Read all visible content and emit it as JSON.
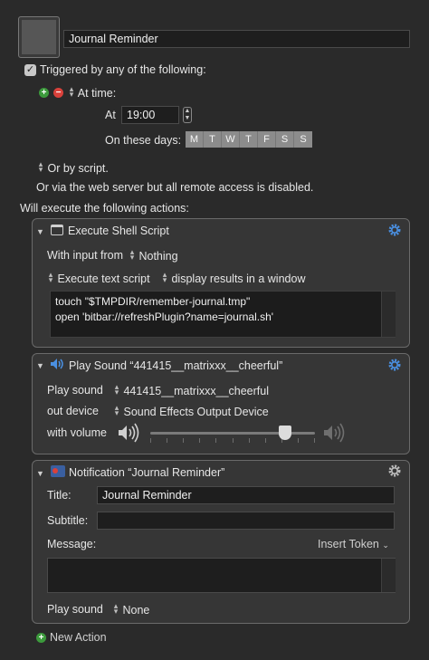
{
  "macro": {
    "name": "Journal Reminder"
  },
  "trigger": {
    "header": "Triggered by any of the following:",
    "at_time_label": "At time:",
    "at_label": "At",
    "time_value": "19:00",
    "days_label": "On these days:",
    "days": [
      "M",
      "T",
      "W",
      "T",
      "F",
      "S",
      "S"
    ],
    "by_script": "Or by script.",
    "web_server": "Or via the web server but all remote access is disabled."
  },
  "actions_header": "Will execute the following actions:",
  "shell_action": {
    "title": "Execute Shell Script",
    "input_label": "With input from",
    "input_value": "Nothing",
    "mode": "Execute text script",
    "output": "display results in a window",
    "script_lines": [
      "touch \"$TMPDIR/remember-journal.tmp\"",
      "open 'bitbar://refreshPlugin?name=journal.sh'"
    ]
  },
  "sound_action": {
    "title": "Play Sound “441415__matrixxx__cheerful”",
    "play_label": "Play sound",
    "play_value": "441415__matrixxx__cheerful",
    "device_label": "out device",
    "device_value": "Sound Effects Output Device",
    "volume_label": "with volume",
    "volume_fraction": 0.82
  },
  "notification_action": {
    "title": "Notification “Journal Reminder”",
    "title_label": "Title:",
    "title_value": "Journal Reminder",
    "subtitle_label": "Subtitle:",
    "subtitle_value": "",
    "message_label": "Message:",
    "insert_token": "Insert Token",
    "message_value": "",
    "sound_label": "Play sound",
    "sound_value": "None"
  },
  "new_action": "New Action",
  "colors": {
    "accent_blue": "#4a90e2",
    "add_green": "#3c9a3c",
    "remove_red": "#d9413b"
  },
  "icons": {
    "checkbox": "check",
    "gear": "gear-icon",
    "terminal": "terminal-icon",
    "speaker": "speaker-icon",
    "notification": "notification-icon"
  }
}
